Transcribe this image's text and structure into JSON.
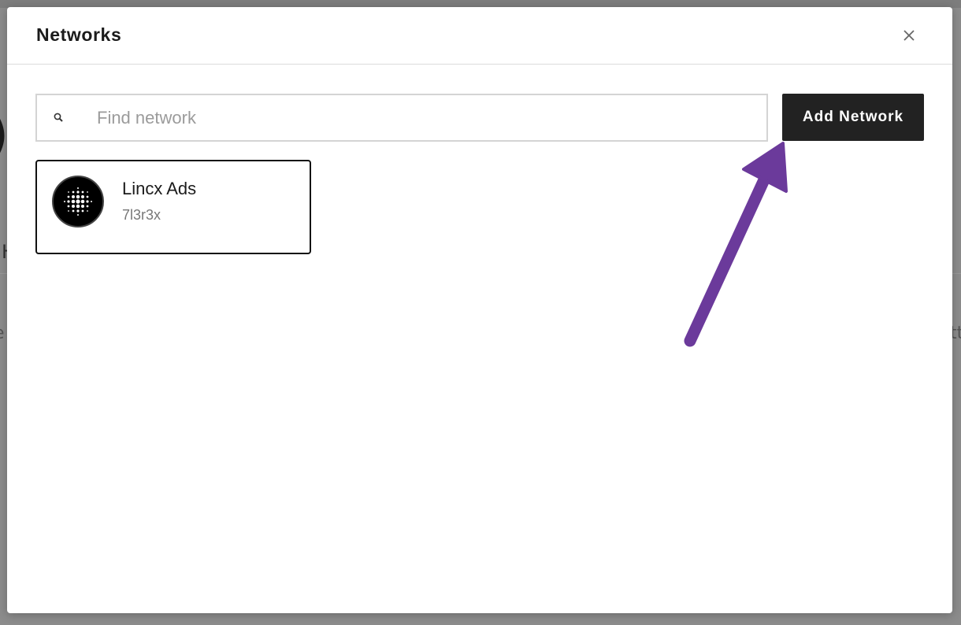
{
  "modal": {
    "title": "Networks",
    "close_icon": "close-icon"
  },
  "search": {
    "placeholder": "Find network",
    "value": "",
    "icon": "search-icon"
  },
  "actions": {
    "add_network_label": "Add Network"
  },
  "networks": [
    {
      "name": "Lincx Ads",
      "id": "7l3r3x",
      "avatar_icon": "lincx-logo-icon"
    }
  ],
  "annotation": {
    "icon": "arrow-annotation-icon",
    "color": "#6b3a9b"
  },
  "colors": {
    "button_bg": "#222222",
    "overlay": "#8c8c8c",
    "accent_arrow": "#6b3a9b"
  }
}
